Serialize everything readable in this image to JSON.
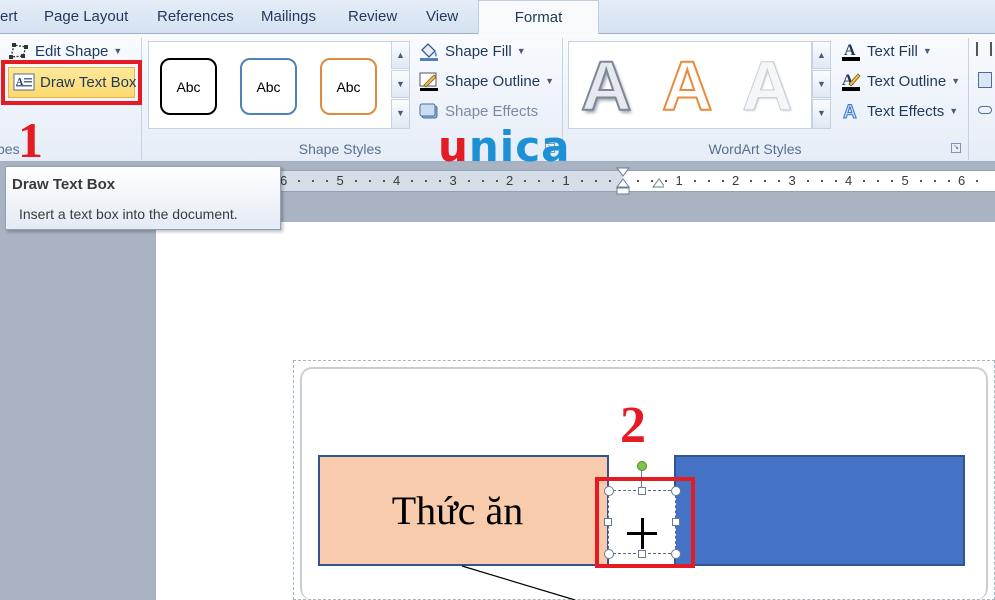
{
  "tabs": [
    {
      "label": "ert",
      "active": false
    },
    {
      "label": "Page Layout",
      "active": false
    },
    {
      "label": "References",
      "active": false
    },
    {
      "label": "Mailings",
      "active": false
    },
    {
      "label": "Review",
      "active": false
    },
    {
      "label": "View",
      "active": false
    },
    {
      "label": "Format",
      "active": true
    }
  ],
  "ribbon": {
    "insert_shapes": {
      "edit_shape_label": "Edit Shape",
      "draw_text_box_label": "Draw Text Box",
      "group_label_partial": "pes"
    },
    "shape_styles": {
      "samples": [
        "Abc",
        "Abc",
        "Abc"
      ],
      "sample_border_colors": [
        "#000000",
        "#4f81bd",
        "#e08b3c"
      ],
      "shape_fill_label": "Shape Fill",
      "shape_outline_label": "Shape Outline",
      "shape_effects_label": "Shape Effects",
      "group_label": "Shape Styles"
    },
    "wordart_styles": {
      "samples": [
        "A",
        "A",
        "A"
      ],
      "text_fill_label": "Text Fill",
      "text_outline_label": "Text Outline",
      "text_effects_label": "Text Effects",
      "group_label": "WordArt Styles"
    }
  },
  "tooltip": {
    "title": "Draw Text Box",
    "description": "Insert a text box into the document."
  },
  "ruler": {
    "left_numbers": [
      "6",
      "5",
      "4",
      "3",
      "2",
      "1"
    ],
    "right_numbers": [
      "1",
      "2",
      "3",
      "4",
      "5",
      "6"
    ]
  },
  "document": {
    "food_box_label": "Thức ăn",
    "food_box_color": "#f8cbad",
    "right_box_color": "#4472c4"
  },
  "annotations": {
    "step_1": "1",
    "step_2": "2",
    "highlight_color": "#e51b24"
  },
  "watermark": {
    "text_u": "u",
    "text_nica": "nica"
  }
}
